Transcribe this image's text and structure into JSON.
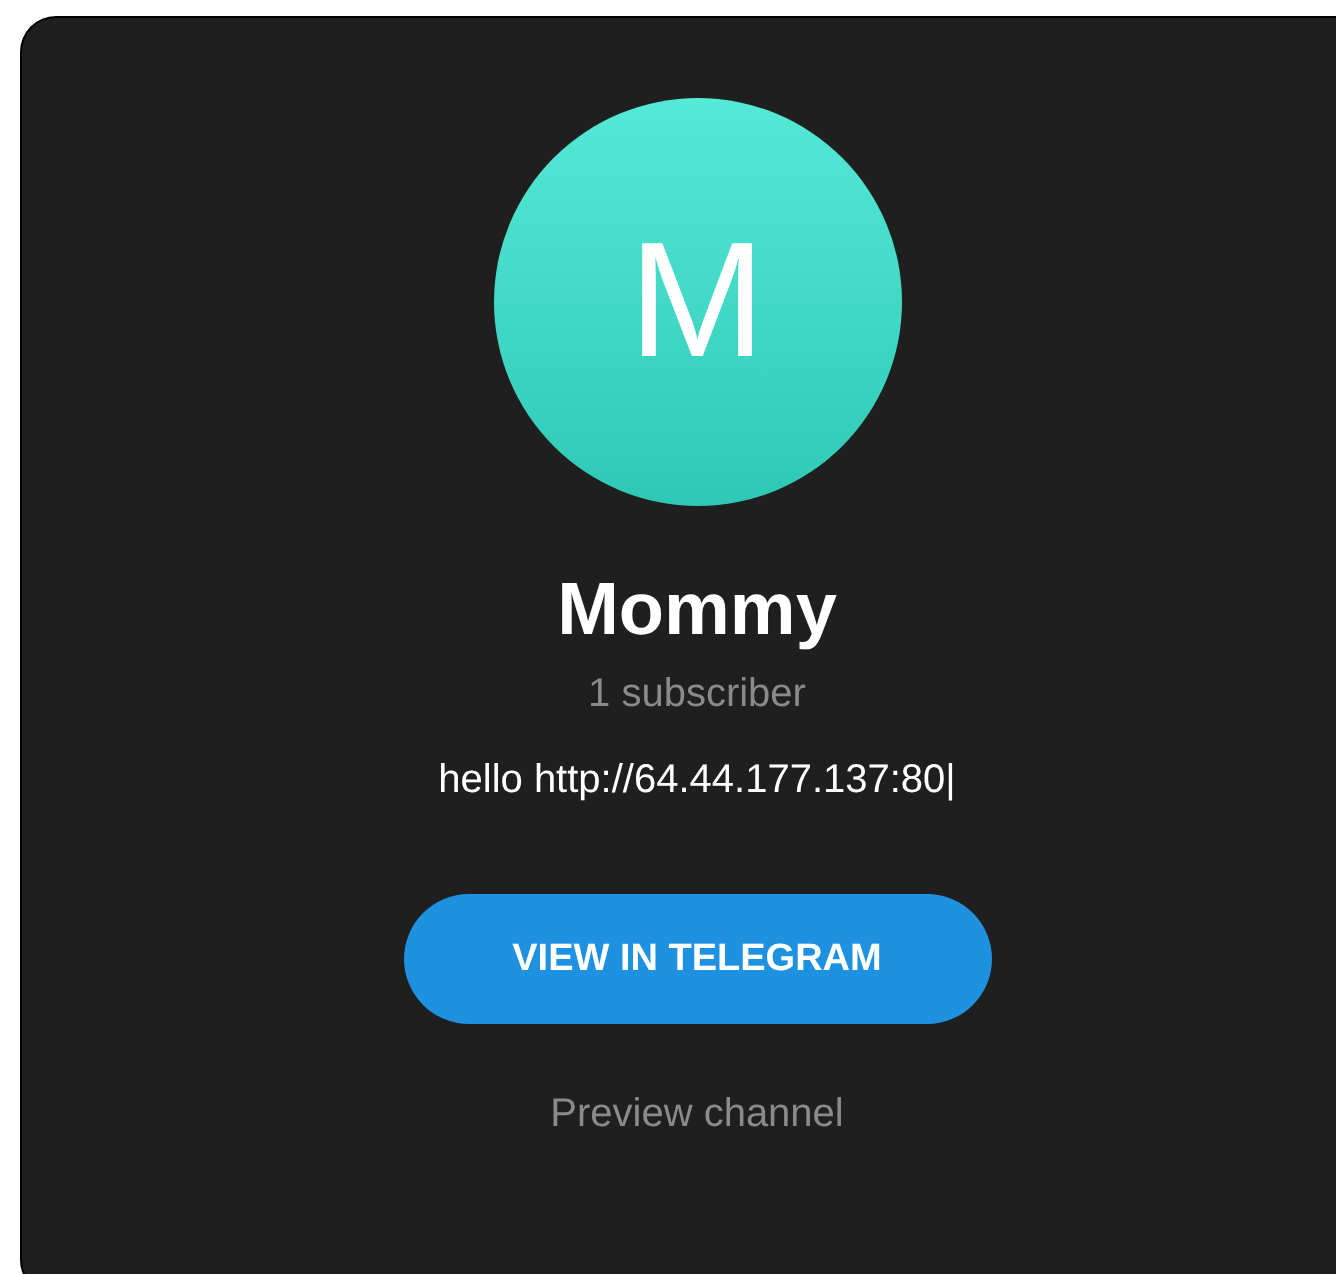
{
  "channel": {
    "avatar_letter": "M",
    "name": "Mommy",
    "subscribers": "1 subscriber",
    "description": "hello http://64.44.177.137:80|"
  },
  "buttons": {
    "primary": "VIEW IN TELEGRAM",
    "secondary": "Preview channel"
  }
}
